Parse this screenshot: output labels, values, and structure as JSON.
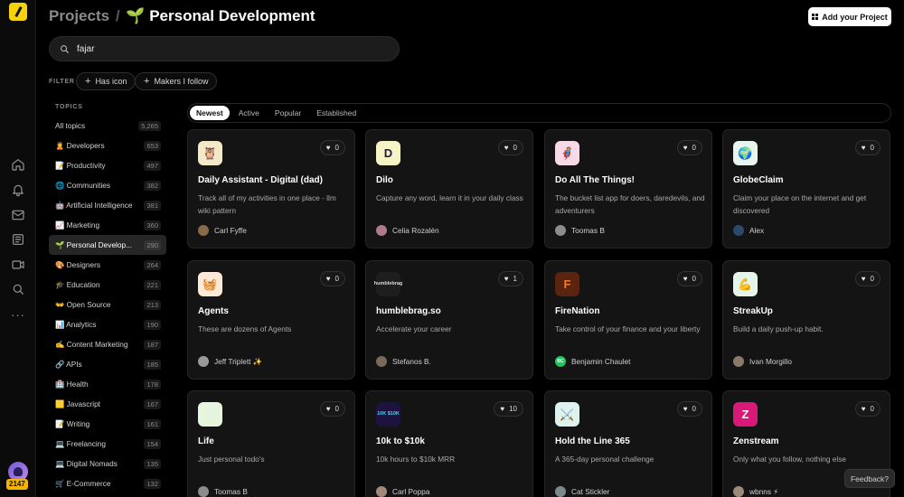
{
  "header": {
    "breadcrumb_root": "Projects",
    "separator": "/",
    "current_icon": "🌱",
    "current_title": "Personal Development",
    "add_button_label": "Add your Project"
  },
  "search": {
    "value": "fajar",
    "icon": "search-icon"
  },
  "filter": {
    "label": "FILTER",
    "chips": [
      "Has icon",
      "Makers I follow"
    ]
  },
  "topics": {
    "label": "TOPICS",
    "items": [
      {
        "label": "All topics",
        "count": "5,265"
      },
      {
        "label": "🙎 Developers",
        "count": "653"
      },
      {
        "label": "📝 Productivity",
        "count": "497"
      },
      {
        "label": "🌐 Communities",
        "count": "382"
      },
      {
        "label": "🤖 Artificial Intelligence",
        "count": "381"
      },
      {
        "label": "📈 Marketing",
        "count": "360"
      },
      {
        "label": "🌱 Personal Develop...",
        "count": "290",
        "active": true
      },
      {
        "label": "🎨 Designers",
        "count": "264"
      },
      {
        "label": "🎓 Education",
        "count": "221"
      },
      {
        "label": "👐 Open Source",
        "count": "213"
      },
      {
        "label": "📊 Analytics",
        "count": "190"
      },
      {
        "label": "✍️ Content Marketing",
        "count": "187"
      },
      {
        "label": "🔗 APIs",
        "count": "185"
      },
      {
        "label": "🏥 Health",
        "count": "178"
      },
      {
        "label": "🟨 Javascript",
        "count": "167"
      },
      {
        "label": "📝 Writing",
        "count": "161"
      },
      {
        "label": "💻 Freelancing",
        "count": "154"
      },
      {
        "label": "💻 Digital Nomads",
        "count": "135"
      },
      {
        "label": "🛒 E-Commerce",
        "count": "132"
      }
    ]
  },
  "tabs": [
    {
      "label": "Newest",
      "active": true
    },
    {
      "label": "Active"
    },
    {
      "label": "Popular"
    },
    {
      "label": "Established"
    }
  ],
  "projects": [
    {
      "name": "Daily Assistant - Digital (dad)",
      "desc": "Track all of my activities in one place - llm wiki pattern",
      "maker": "Carl Fyffe",
      "likes": "0",
      "icon_text": "🦉",
      "icon_bg": "#f3e9c8",
      "av": "#8a6a4a"
    },
    {
      "name": "Dilo",
      "desc": "Capture any word, learn it in your daily class",
      "maker": "Celia Rozalén",
      "likes": "0",
      "icon_text": "D",
      "icon_bg": "#f6f4c6",
      "icon_color": "#1a1a3a",
      "av": "#b07a8a"
    },
    {
      "name": "Do All The Things!",
      "desc": "The bucket list app for doers, daredevils, and adventurers",
      "maker": "Toomas B",
      "likes": "0",
      "icon_text": "🦸",
      "icon_bg": "#f7d9e8",
      "av": "#8c8c8c"
    },
    {
      "name": "GlobeClaim",
      "desc": "Claim your place on the internet and get discovered",
      "maker": "Alex",
      "likes": "0",
      "icon_text": "🌍",
      "icon_bg": "#e8f4ee",
      "av": "#2a4a6a"
    },
    {
      "name": "Agents",
      "desc": "These are dozens of Agents",
      "maker": "Jeff Triplett ✨",
      "likes": "0",
      "icon_text": "🧺",
      "icon_bg": "#fde9d6",
      "av": "#9a9a9a"
    },
    {
      "name": "humblebrag.so",
      "desc": "Accelerate your career",
      "maker": "Stefanos B.",
      "likes": "1",
      "icon_text": "humblebrag",
      "icon_bg": "#1e1e1e",
      "icon_color": "#dcdcdc",
      "av": "#7a6a5a"
    },
    {
      "name": "FireNation",
      "desc": "Take control of your finance and your liberty",
      "maker": "Benjamin Chaulet",
      "likes": "0",
      "icon_text": "F",
      "icon_bg": "#5a2410",
      "icon_color": "#f07a30",
      "av": "#22c55e",
      "av_text": "BC"
    },
    {
      "name": "StreakUp",
      "desc": "Build a daily push-up habit.",
      "maker": "Ivan Morgillo",
      "likes": "0",
      "icon_text": "💪",
      "icon_bg": "#e4f6ea",
      "av": "#8a7a6a"
    },
    {
      "name": "Life",
      "desc": "Just personal todo's",
      "maker": "Toomas B",
      "likes": "0",
      "icon_text": "😘",
      "icon_bg": "#e5f6dd",
      "av": "#8c8c8c"
    },
    {
      "name": "10k to $10k",
      "desc": "10k hours to $10k MRR",
      "maker": "Carl Poppa",
      "likes": "10",
      "icon_text": "10K $10K",
      "icon_bg": "#1d1240",
      "icon_color": "#4ad6f0",
      "av": "#a08a7a"
    },
    {
      "name": "Hold the Line 365",
      "desc": "A 365-day personal challenge",
      "maker": "Cat Stickler",
      "likes": "0",
      "icon_text": "⚔️",
      "icon_bg": "#dff3ee",
      "av": "#7a8a8a"
    },
    {
      "name": "Zenstream",
      "desc": "Only what you follow, nothing else",
      "maker": "wbnns ⚡",
      "likes": "0",
      "icon_text": "Z",
      "icon_bg": "#d8197a",
      "icon_color": "#ffffff",
      "av": "#9a8a7a"
    }
  ],
  "rail": {
    "badge": "2147"
  },
  "feedback_label": "Feedback?"
}
